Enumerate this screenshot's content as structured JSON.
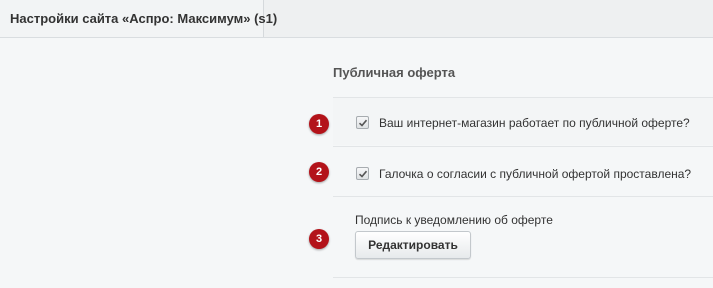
{
  "header": {
    "tab_title": "Настройки сайта «Аспро: Максимум» (s1)"
  },
  "section": {
    "title": "Публичная оферта"
  },
  "items": [
    {
      "badge": "1",
      "label": "Ваш интернет-магазин работает по публичной оферте?",
      "checked": true
    },
    {
      "badge": "2",
      "label": "Галочка о согласии с публичной офертой проставлена?",
      "checked": true
    },
    {
      "badge": "3",
      "label": "Подпись к уведомлению об оферте",
      "button_label": "Редактировать"
    }
  ],
  "colors": {
    "badge": "#b3131a",
    "background": "#f5f7f8"
  }
}
